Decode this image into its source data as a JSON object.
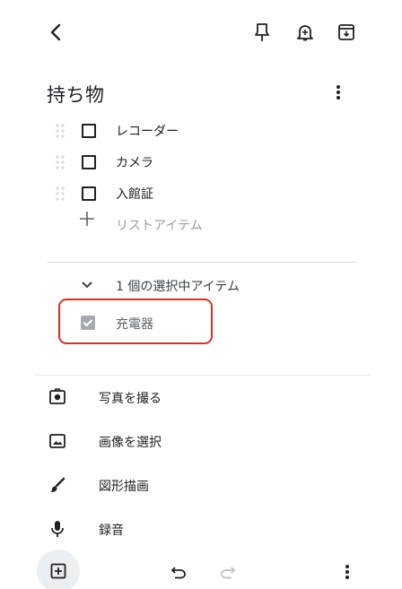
{
  "note": {
    "title": "持ち物",
    "items": [
      {
        "label": "レコーダー"
      },
      {
        "label": "カメラ"
      },
      {
        "label": "入館証"
      }
    ],
    "add_item_placeholder": "リストアイテム",
    "completed_header": "1 個の選択中アイテム",
    "completed_items": [
      {
        "label": "充電器"
      }
    ]
  },
  "menu": {
    "items": [
      {
        "label": "写真を撮る",
        "icon": "camera-icon"
      },
      {
        "label": "画像を選択",
        "icon": "image-icon"
      },
      {
        "label": "図形描画",
        "icon": "brush-icon"
      },
      {
        "label": "録音",
        "icon": "mic-icon"
      }
    ]
  },
  "toolbar": {
    "top_icons": [
      "back-arrow-icon",
      "pin-icon",
      "reminder-bell-icon",
      "archive-icon"
    ],
    "bottom_icons": [
      "add-box-icon",
      "undo-icon",
      "redo-icon",
      "more-vert-icon"
    ]
  },
  "colors": {
    "text": "#202124",
    "muted": "#9aa0a6",
    "highlight": "#d93025",
    "checked_box": "#a7a9ac"
  }
}
